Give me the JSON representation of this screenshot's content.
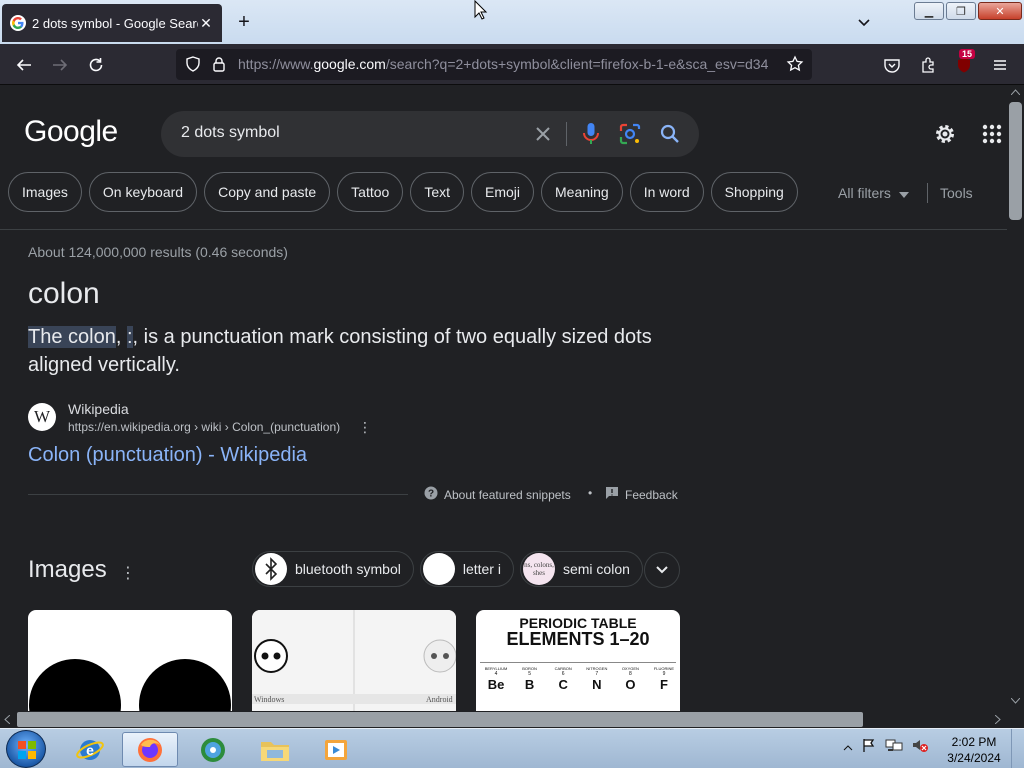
{
  "browser": {
    "tab_title": "2 dots symbol - Google Search",
    "url_prefix": "https://www.",
    "url_domain": "google.com",
    "url_rest": "/search?q=2+dots+symbol&client=firefox-b-1-e&sca_esv=d34",
    "extension_badge": "15"
  },
  "search": {
    "logo": "Google",
    "query": "2 dots symbol",
    "chips": [
      "Images",
      "On keyboard",
      "Copy and paste",
      "Tattoo",
      "Text",
      "Emoji",
      "Meaning",
      "In word",
      "Shopping"
    ],
    "all_filters": "All filters",
    "tools": "Tools"
  },
  "results": {
    "stats": "About 124,000,000 results (0.46 seconds)",
    "answer": "colon",
    "snippet_highlight": "The colon",
    "snippet_sep": ", ",
    "snippet_symbol": ":",
    "snippet_rest": ", is a punctuation mark consisting of two equally sized dots aligned vertically.",
    "source_icon": "W",
    "source_name": "Wikipedia",
    "source_url": "https://en.wikipedia.org › wiki › Colon_(punctuation)",
    "source_link": "Colon (punctuation) - Wikipedia",
    "about_snippets": "About featured snippets",
    "separator_dot": "•",
    "feedback": "Feedback"
  },
  "images": {
    "title": "Images",
    "suggestions": [
      "bluetooth symbol",
      "letter i",
      "semi colon"
    ],
    "suggestion_thumb_text": "ns, colons, shes",
    "thumb2_left_caption": "Windows",
    "thumb2_right_caption": "Android",
    "thumb3_line1": "PERIODIC TABLE",
    "thumb3_line2": "ELEMENTS 1–20",
    "thumb3_elements": [
      "Be",
      "B",
      "C",
      "N",
      "O",
      "F"
    ],
    "thumb3_names": [
      "BERYLLIUM",
      "BORON",
      "CARBON",
      "NITROGEN",
      "OXYGEN",
      "FLUORINE"
    ],
    "thumb3_numbers": [
      "4",
      "5",
      "6",
      "7",
      "8",
      "9"
    ]
  },
  "taskbar": {
    "time": "2:02 PM",
    "date": "3/24/2024"
  },
  "colors": {
    "page_bg": "#202124",
    "link": "#8ab4f8",
    "chrome": "#2b2a33"
  }
}
